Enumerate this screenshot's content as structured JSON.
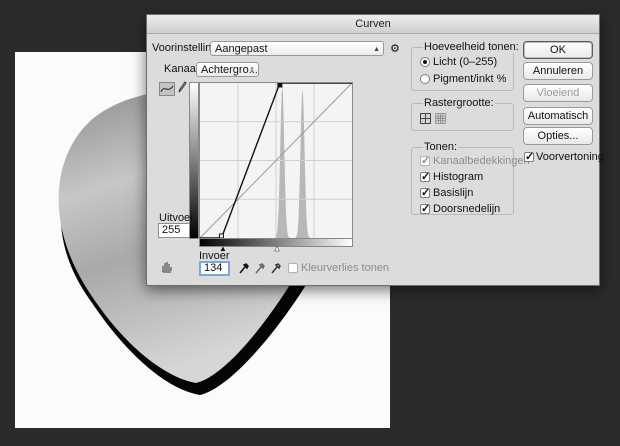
{
  "dialog": {
    "title": "Curven",
    "preset_label": "Voorinstelling:",
    "preset_value": "Aangepast",
    "channel_label": "Kanaal:",
    "channel_value": "Achtergro...",
    "output_label": "Uitvoer",
    "output_value": "255",
    "input_label": "Invoer",
    "input_value": "134",
    "color_loss_label": "Kleurverlies tonen"
  },
  "amount": {
    "title": "Hoeveelheid tonen:",
    "option_light": "Licht (0–255)",
    "option_pigment": "Pigment/inkt %",
    "selected": "light"
  },
  "grid_size": {
    "title": "Rastergrootte:"
  },
  "show": {
    "title": "Tonen:",
    "items": [
      {
        "label": "Kanaalbedekkingen",
        "checked": true,
        "enabled": false
      },
      {
        "label": "Histogram",
        "checked": true,
        "enabled": true
      },
      {
        "label": "Basislijn",
        "checked": true,
        "enabled": true
      },
      {
        "label": "Doorsnedelijn",
        "checked": true,
        "enabled": true
      }
    ]
  },
  "buttons": {
    "ok": "OK",
    "cancel": "Annuleren",
    "smooth": "Vloeiend",
    "auto": "Automatisch",
    "options": "Opties...",
    "preview_label": "Voorvertoning",
    "preview_checked": true
  },
  "curve": {
    "histogram_peaks": [
      {
        "center": 138,
        "spread": 3.4,
        "height": 0.98
      },
      {
        "center": 172,
        "spread": 3.4,
        "height": 0.96
      }
    ],
    "black_point": {
      "input": 36,
      "output": 0
    },
    "white_point": {
      "input": 134,
      "output": 255
    },
    "colors": {
      "curve": "#111111",
      "histogram": "#b8b8b8",
      "baseline": "#9a9a9a",
      "grid": "#cfcfcf"
    }
  }
}
